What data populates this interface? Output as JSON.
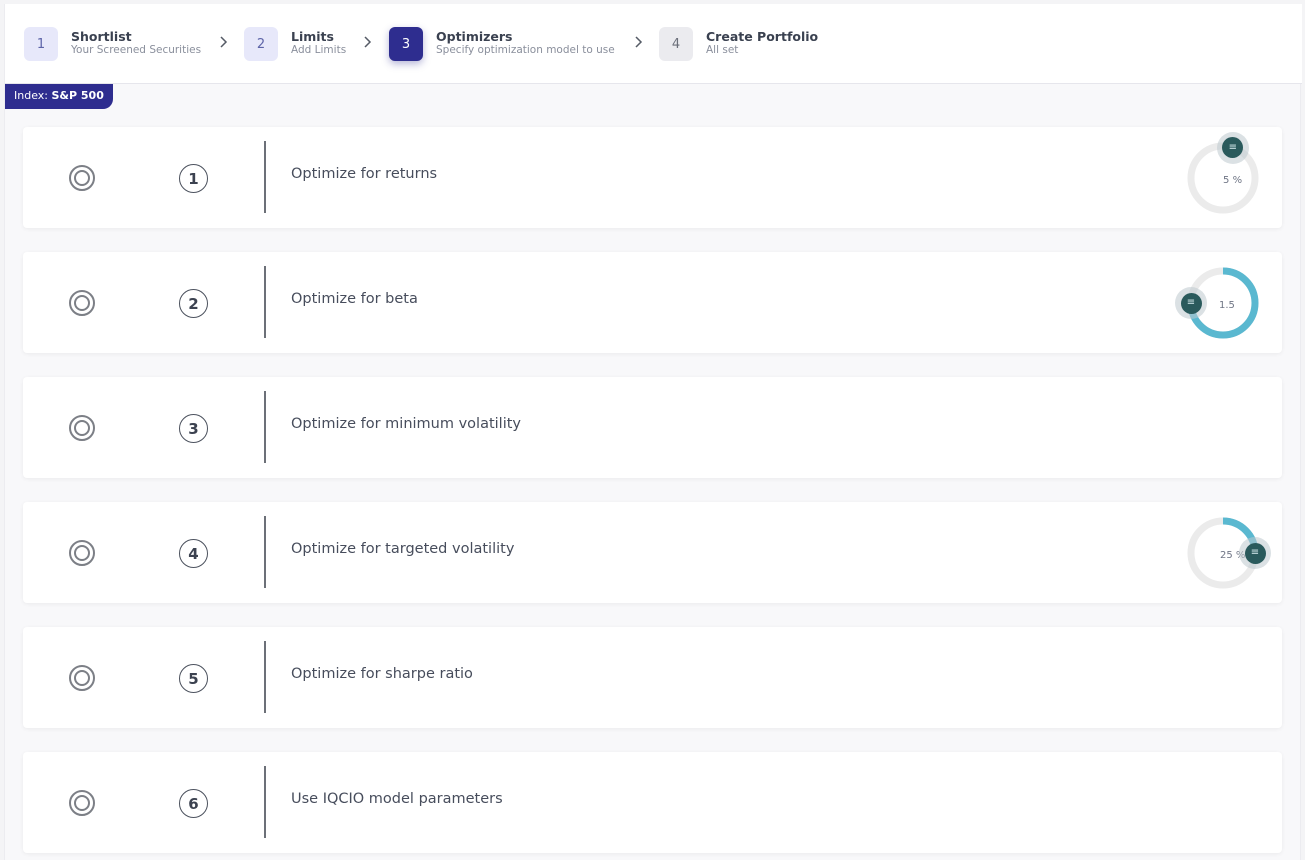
{
  "stepper": {
    "steps": [
      {
        "num": "1",
        "title": "Shortlist",
        "subtitle": "Your Screened Securities",
        "state": "done"
      },
      {
        "num": "2",
        "title": "Limits",
        "subtitle": "Add Limits",
        "state": "done"
      },
      {
        "num": "3",
        "title": "Optimizers",
        "subtitle": "Specify optimization model to use",
        "state": "active"
      },
      {
        "num": "4",
        "title": "Create Portfolio",
        "subtitle": "All set",
        "state": "pending"
      }
    ]
  },
  "index_tag": {
    "prefix": "Index: ",
    "value": "S&P 500"
  },
  "colors": {
    "accent": "#2e2d8f",
    "dial_fill": "#5ab8d0",
    "dial_track": "#ebebeb",
    "knob": "#2a5a5c"
  },
  "optimizers": [
    {
      "num": "1",
      "label": "Optimize for returns",
      "dial": {
        "value": "5",
        "unit": "%",
        "level": 0.05
      }
    },
    {
      "num": "2",
      "label": "Optimize for beta",
      "dial": {
        "value": "1.5",
        "unit": "",
        "level": 0.75
      }
    },
    {
      "num": "3",
      "label": "Optimize for minimum volatility"
    },
    {
      "num": "4",
      "label": "Optimize for targeted volatility",
      "dial": {
        "value": "25",
        "unit": "%",
        "level": 0.25
      }
    },
    {
      "num": "5",
      "label": "Optimize for sharpe ratio"
    },
    {
      "num": "6",
      "label": "Use IQCIO model parameters"
    }
  ]
}
